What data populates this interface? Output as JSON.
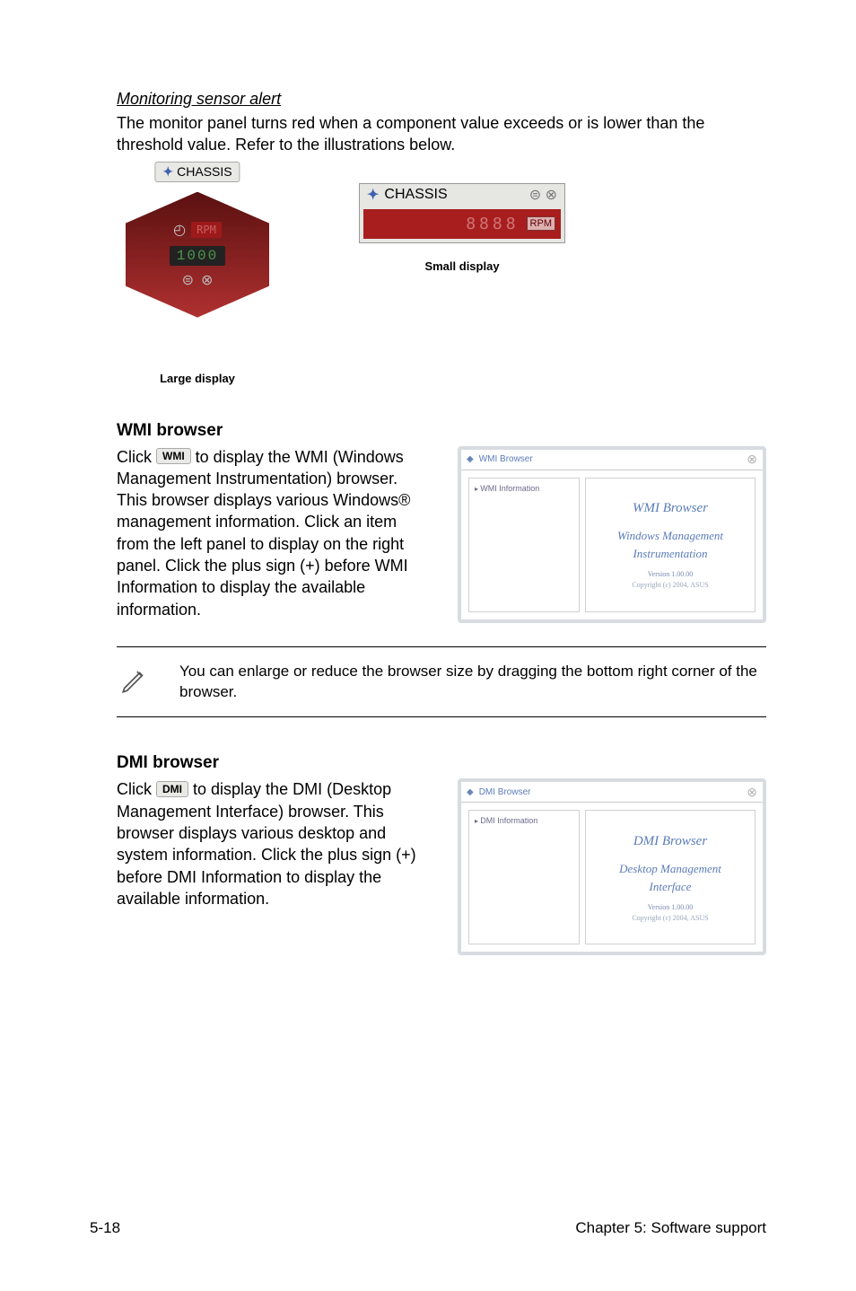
{
  "section_alert": {
    "heading": "Monitoring sensor alert",
    "body": "The monitor panel turns red when a component value exceeds or is lower than the threshold value. Refer to the illustrations below.",
    "chassis_label": "CHASSIS",
    "rpm_label": "RPM",
    "digital_readout": "1000",
    "caption_large": "Large display",
    "caption_small": "Small display"
  },
  "wmi": {
    "heading": "WMI browser",
    "button": "WMI",
    "body_prefix": "Click ",
    "body_suffix": " to display the WMI (Windows Management Instrumentation) browser. This browser displays various Windows® management information. Click an item from the left panel to display on the right panel. Click the plus sign (+) before WMI Information to display the available information.",
    "window_titlebar": "WMI Browser",
    "tree_root": "WMI Information",
    "content_title": "WMI Browser",
    "content_sub1": "Windows Management",
    "content_sub2": "Instrumentation",
    "version": "Version 1.00.00",
    "copyright": "Copyright (c) 2004, ASUS"
  },
  "note": {
    "text": "You can enlarge or reduce the browser size by dragging the bottom right corner of the browser."
  },
  "dmi": {
    "heading": "DMI browser",
    "button": "DMI",
    "body_prefix": "Click ",
    "body_suffix": " to display the DMI (Desktop Management Interface) browser. This browser displays various desktop and system information. Click the plus sign (+) before DMI Information to display the available information.",
    "window_titlebar": "DMI Browser",
    "tree_root": "DMI Information",
    "content_title": "DMI Browser",
    "content_sub1": "Desktop Management",
    "content_sub2": "Interface",
    "version": "Version 1.00.00",
    "copyright": "Copyright (c) 2004, ASUS"
  },
  "footer": {
    "left": "5-18",
    "right": "Chapter 5: Software support"
  }
}
